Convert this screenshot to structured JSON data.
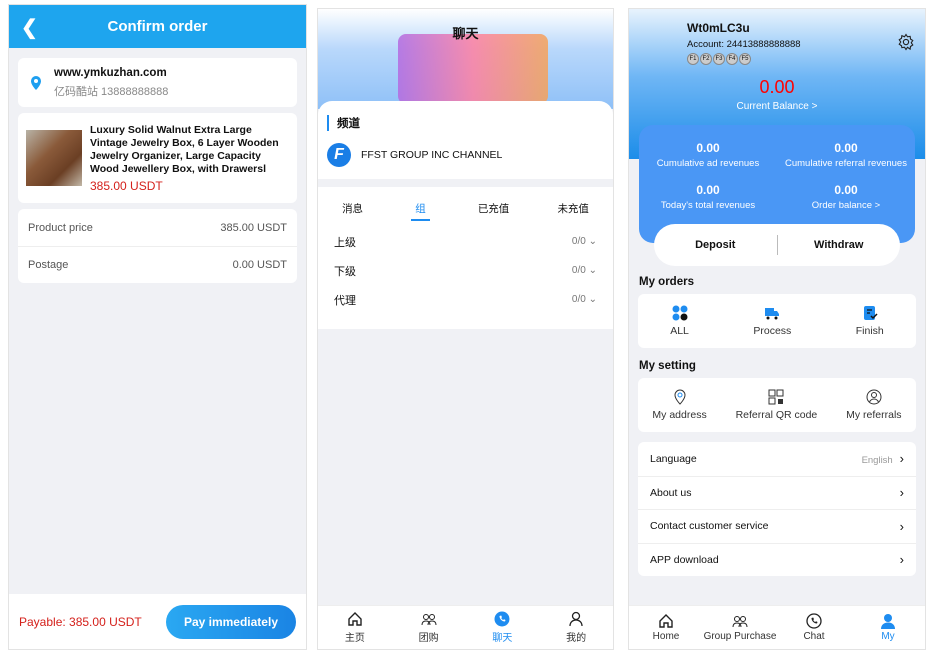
{
  "order": {
    "title": "Confirm order",
    "address": {
      "site": "www.ymkuzhan.com",
      "contact": "亿码酷站 13888888888"
    },
    "product": {
      "name": "Luxury Solid Walnut Extra Large Vintage Jewelry Box, 6 Layer Wooden Jewelry Organizer, Large Capacity Wood Jewellery Box, with Drawersl",
      "price": "385.00 USDT"
    },
    "rows": [
      {
        "label": "Product price",
        "value": "385.00 USDT"
      },
      {
        "label": "Postage",
        "value": "0.00 USDT"
      }
    ],
    "payable": "Payable: 385.00 USDT",
    "pay_button": "Pay immediately"
  },
  "chat": {
    "title": "聊天",
    "channel_heading": "频道",
    "channel_name": "FFST GROUP INC CHANNEL",
    "tabs": [
      "消息",
      "组",
      "已充值",
      "未充值"
    ],
    "active_tab": 1,
    "groups": [
      {
        "label": "上级",
        "count": "0/0"
      },
      {
        "label": "下级",
        "count": "0/0"
      },
      {
        "label": "代理",
        "count": "0/0"
      }
    ],
    "nav": [
      {
        "label": "主页",
        "icon": "home-icon"
      },
      {
        "label": "团购",
        "icon": "group-icon"
      },
      {
        "label": "聊天",
        "icon": "chat-icon"
      },
      {
        "label": "我的",
        "icon": "user-icon"
      }
    ],
    "active_nav": 2
  },
  "profile": {
    "username": "Wt0mLC3u",
    "account": "Account: 24413888888888",
    "badges": [
      "F1",
      "F2",
      "F3",
      "F4",
      "F5"
    ],
    "balance": "0.00",
    "balance_label": "Current Balance >",
    "stats": [
      {
        "value": "0.00",
        "label": "Cumulative ad revenues"
      },
      {
        "value": "0.00",
        "label": "Cumulative referral revenues"
      },
      {
        "value": "0.00",
        "label": "Today's total revenues"
      },
      {
        "value": "0.00",
        "label": "Order balance >"
      }
    ],
    "deposit": "Deposit",
    "withdraw": "Withdraw",
    "orders_title": "My orders",
    "orders": [
      "ALL",
      "Process",
      "Finish"
    ],
    "settings_title": "My setting",
    "settings": [
      "My address",
      "Referral QR code",
      "My referrals"
    ],
    "menu": [
      {
        "label": "Language",
        "value": "English"
      },
      {
        "label": "About us"
      },
      {
        "label": "Contact customer service"
      },
      {
        "label": "APP download"
      }
    ],
    "nav": [
      {
        "label": "Home",
        "icon": "home-icon"
      },
      {
        "label": "Group Purchase",
        "icon": "group-icon"
      },
      {
        "label": "Chat",
        "icon": "chat-icon"
      },
      {
        "label": "My",
        "icon": "user-icon"
      }
    ],
    "active_nav": 3,
    "colors": {
      "accent": "#1e8cf0",
      "balance": "#ff0000",
      "price": "#d4201b"
    }
  }
}
